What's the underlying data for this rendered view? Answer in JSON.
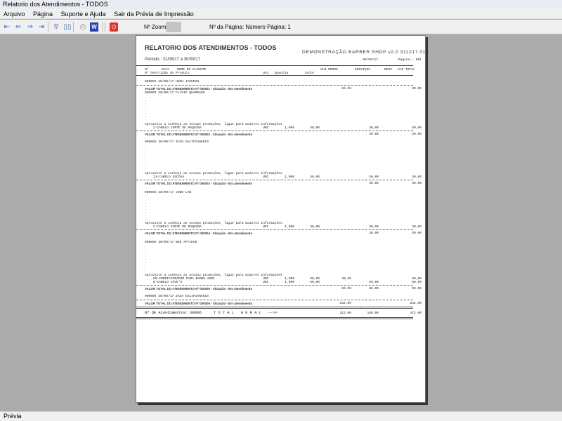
{
  "window": {
    "title": "Relatorio dos Atendimentos - TODOS"
  },
  "menu": [
    "Arquivo",
    "Página",
    "Suporte e Ajuda",
    "Sair da Prévia de Impressão"
  ],
  "toolbar": {
    "zoom_label": "Nº Zoom",
    "page_label": "Nº da Página: Número Página: 1",
    "buttons": [
      {
        "icon": "first-page-icon",
        "glyph": "⇤"
      },
      {
        "icon": "prev-page-icon",
        "glyph": "⇐"
      },
      {
        "icon": "next-page-icon",
        "glyph": "⇒"
      },
      {
        "icon": "last-page-icon",
        "glyph": "⇥"
      },
      {
        "icon": "zoom-icon",
        "glyph": "⚲"
      },
      {
        "icon": "book-view-icon",
        "glyph": "▯▯"
      },
      {
        "icon": "print-icon",
        "glyph": "⎙"
      },
      {
        "icon": "word-export-icon",
        "glyph": "W"
      },
      {
        "icon": "exit-icon",
        "glyph": "⏻"
      }
    ]
  },
  "report": {
    "title": "RELATORIO DOS ATENDIMENTOS - TODOS",
    "company": "DEMONSTRAÇÃO BARBER SHOP v2.0 311217 010",
    "period": "Periodo.: 31/08/17 à 30/09/17",
    "date": "30/09/17",
    "page": "Pagina.: 001",
    "header1": {
      "num": "Nº",
      "date": "DATA",
      "client": "NOME DO CLIENTE"
    },
    "header2": {
      "num_desc": "Nº Descrição do Produto",
      "uni": "Uni",
      "qty": "Quantia",
      "value": "Valor",
      "prods": "VLR PRODS",
      "services": "SERVIÇOS",
      "disc": "DESC.",
      "total": "VLR TOTAL"
    },
    "promo": "Aproveite a conheça as nossas promoções, ligue para maiores informações",
    "attendances": [
      {
        "head": "000001 30/09/17 HUGH JACKMAN",
        "items": [],
        "total_label": "VALOR TOTAL DO ATENDIMENTO Nº 000001 - Situação - Em atendimento",
        "prods": "30.00",
        "services": "",
        "total": "30.00"
      },
      {
        "head": "000002 30/09/17 FLÁVIO QUADRADO",
        "items": [
          {
            "desc": "2-CABELO CORTE DE MÁQUINA",
            "uni": "UNI",
            "qty": "1,000",
            "value": "30,00",
            "prods": "",
            "services": "30,00",
            "total": "30,00"
          }
        ],
        "total_label": "VALOR TOTAL DO ATENDIMENTO Nº 000002 - Situação - Em atendimento",
        "prods": "",
        "services": "30.00",
        "total": "30.00"
      },
      {
        "head": "000003 30/09/17 ZACH GALIFIANAKIS",
        "items": [
          {
            "desc": "13-CABELO ESCOVA",
            "uni": "UNI",
            "qty": "1,000",
            "value": "40,00",
            "prods": "",
            "services": "40,00",
            "total": "40,00"
          }
        ],
        "total_label": "VALOR TOTAL DO ATENDIMENTO Nº 000003 - Situação - Em atendimento",
        "prods": "",
        "services": "40.00",
        "total": "40.00"
      },
      {
        "head": "000004 30/09/17 JUDE LAW",
        "items": [
          {
            "desc": "2-CABELO CORTE DE MÁQUINA",
            "uni": "UNI",
            "qty": "1,000",
            "value": "30,00",
            "prods": "",
            "services": "30,00",
            "total": "30,00"
          }
        ],
        "total_label": "VALOR TOTAL DO ATENDIMENTO Nº 000004 - Situação - Em atendimento",
        "prods": "",
        "services": "30.00",
        "total": "30.00"
      },
      {
        "head": "000005 30/09/17 BEN AFFLECK",
        "items": [
          {
            "desc": "50-CONDICIONADOR PARA BARBA 60ML",
            "uni": "UNI",
            "qty": "1,000",
            "value": "30,00",
            "prods": "30,00",
            "services": "",
            "total": "30,00"
          },
          {
            "desc": "6-CABELO COVE'S",
            "uni": "UNI",
            "qty": "1,000",
            "value": "60,00",
            "prods": "",
            "services": "60,00",
            "total": "60,00"
          }
        ],
        "total_label": "VALOR TOTAL DO ATENDIMENTO Nº 000005 - Situação - Em atendimento",
        "prods": "30.00",
        "services": "60.00",
        "total": "90.00"
      },
      {
        "head": "000006 30/09/17 ZACH GALIFIANAKIS",
        "items": [],
        "total_label": "VALOR TOTAL DO ATENDIMENTO Nº 000006 - Situação - Em atendimento",
        "prods": "232.00",
        "services": "",
        "total": "232.00"
      }
    ],
    "grand": {
      "count": "Nº de Atendimentos: 00006",
      "label": "T O T A L   G E R A L   -->>",
      "prods": "312.00",
      "services": "160.00",
      "total": "472.00"
    }
  },
  "status": "Prévia"
}
